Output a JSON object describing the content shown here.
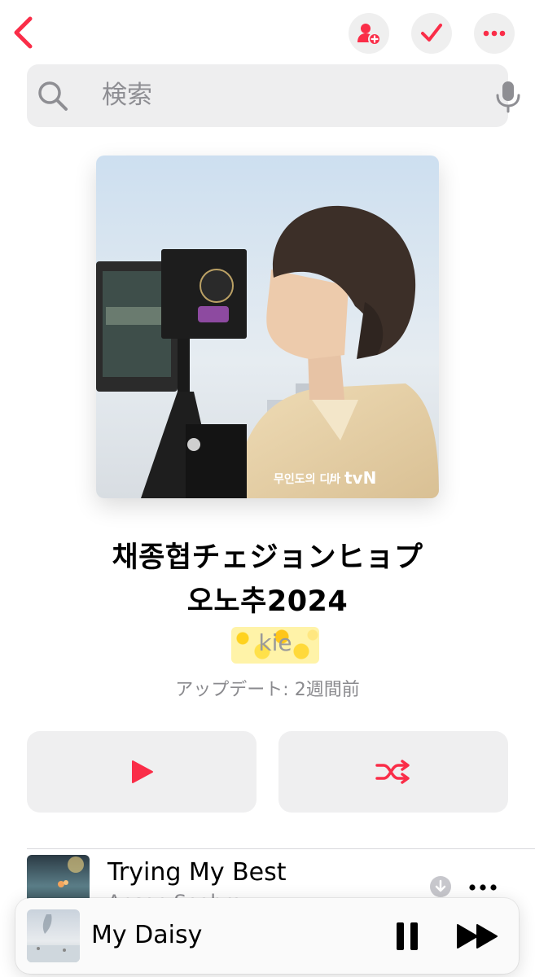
{
  "colors": {
    "accent": "#fa2d48",
    "secondary_text": "#8e8e93"
  },
  "header": {
    "back_icon": "chevron-left-icon",
    "add_person_icon": "person-add-icon",
    "check_icon": "checkmark-icon",
    "more_icon": "ellipsis-icon"
  },
  "search": {
    "placeholder": "検索",
    "value": ""
  },
  "playlist": {
    "cover_badge_left": "무인도의 디바",
    "cover_badge_right": "tvN",
    "title_line1": "채종협チェジョンヒョプ",
    "title_line2": "오노추2024",
    "curator": "kie",
    "updated": "アップデート: 2週間前"
  },
  "actions": {
    "play_icon": "play-icon",
    "shuffle_icon": "shuffle-icon"
  },
  "tracks": [
    {
      "title": "Trying My Best",
      "artist": "Anson Seabra",
      "downloaded_icon": "download-icon"
    }
  ],
  "now_playing": {
    "title": "My Daisy",
    "pause_icon": "pause-icon",
    "next_icon": "forward-icon"
  }
}
